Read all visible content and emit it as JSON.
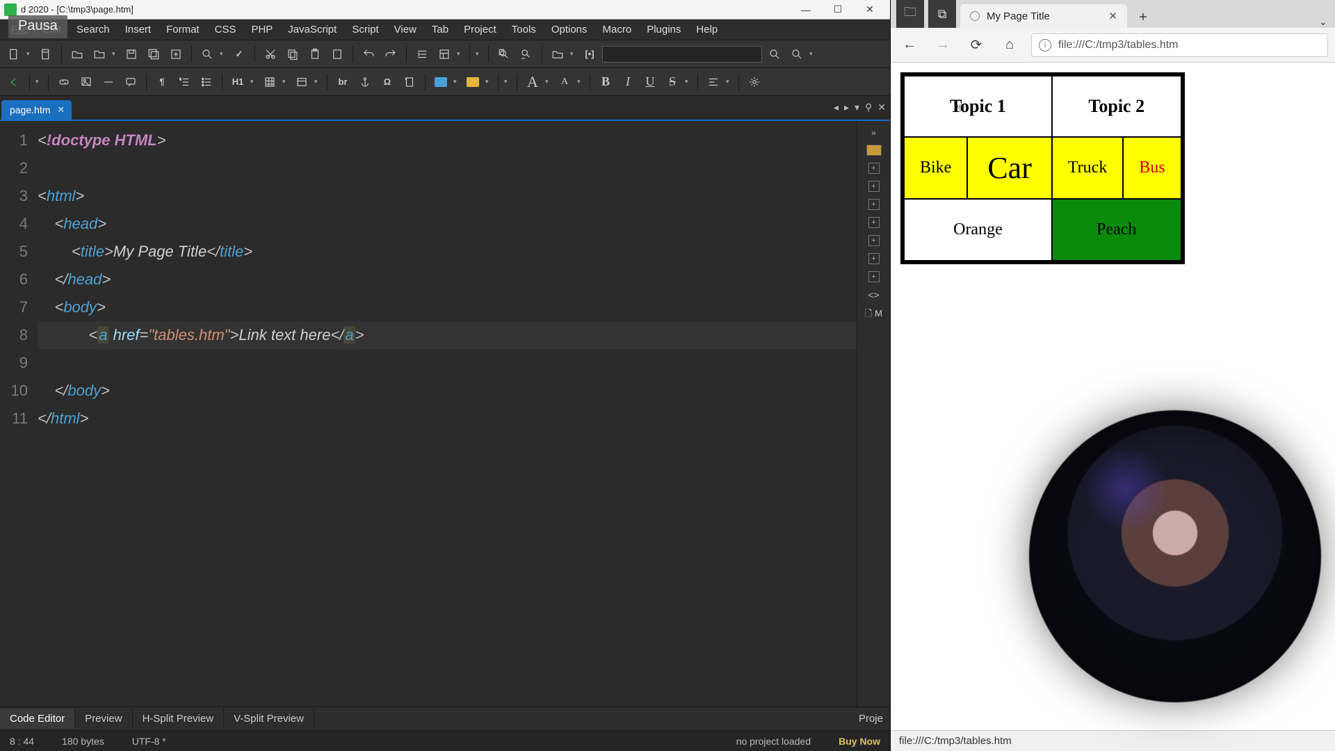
{
  "editor": {
    "titlebar": {
      "app_title_left": "",
      "app_title": "d 2020 - [C:\\tmp3\\page.htm]",
      "pausa": "Pausa"
    },
    "menu": [
      "File",
      "Edit",
      "Search",
      "Insert",
      "Format",
      "CSS",
      "PHP",
      "JavaScript",
      "Script",
      "View",
      "Tab",
      "Project",
      "Tools",
      "Options",
      "Macro",
      "Plugins",
      "Help"
    ],
    "toolbar2": {
      "br_label": "br",
      "h_label": "H1",
      "bold": "B",
      "italic": "I",
      "underline": "U",
      "strike": "S"
    },
    "file_tab": {
      "name": "page.htm"
    },
    "dock_label": "M",
    "code_lines": [
      {
        "n": "1",
        "html": "<span class='tok-punct'>&lt;</span><span class='tok-doctype'>!doctype HTML</span><span class='tok-punct'>&gt;</span>"
      },
      {
        "n": "2",
        "html": ""
      },
      {
        "n": "3",
        "html": "<span class='tok-punct'>&lt;</span><span class='tok-tag'>html</span><span class='tok-punct'>&gt;</span>"
      },
      {
        "n": "4",
        "html": "    <span class='tok-punct'>&lt;</span><span class='tok-tag'>head</span><span class='tok-punct'>&gt;</span>"
      },
      {
        "n": "5",
        "html": "        <span class='tok-punct'>&lt;</span><span class='tok-tag'>title</span><span class='tok-punct'>&gt;</span><span class='tok-text'>My Page Title</span><span class='tok-punct'>&lt;/</span><span class='tok-tag'>title</span><span class='tok-punct'>&gt;</span>"
      },
      {
        "n": "6",
        "html": "    <span class='tok-punct'>&lt;/</span><span class='tok-tag'>head</span><span class='tok-punct'>&gt;</span>"
      },
      {
        "n": "7",
        "html": "    <span class='tok-punct'>&lt;</span><span class='tok-tag'>body</span><span class='tok-punct'>&gt;</span>"
      },
      {
        "n": "8",
        "hl": true,
        "html": "            <span class='tok-punct'>&lt;</span><span class='tok-a-tag'>a</span> <span class='tok-attr'>href</span><span class='tok-punct'>=</span><span class='tok-string'>\"tables.htm\"</span><span class='tok-punct'>&gt;</span><span class='tok-text'>Link text here</span><span class='tok-punct'>&lt;/</span><span class='tok-a-tag'>a</span><span class='tok-punct'>&gt;</span>"
      },
      {
        "n": "9",
        "html": ""
      },
      {
        "n": "10",
        "html": "    <span class='tok-punct'>&lt;/</span><span class='tok-tag'>body</span><span class='tok-punct'>&gt;</span>"
      },
      {
        "n": "11",
        "html": "<span class='tok-punct'>&lt;/</span><span class='tok-tag'>html</span><span class='tok-punct'>&gt;</span>"
      }
    ],
    "bottom_tabs": [
      "Code Editor",
      "Preview",
      "H-Split Preview",
      "V-Split Preview"
    ],
    "bottom_right": "Proje",
    "status": {
      "pos": "8 : 44",
      "size": "180 bytes",
      "enc": "UTF-8 *",
      "proj": "no project loaded",
      "buy": "Buy Now"
    }
  },
  "browser": {
    "tab_title": "My Page Title",
    "address": "file:///C:/tmp3/tables.htm",
    "status": "file:///C:/tmp3/tables.htm",
    "table": {
      "headers": [
        "Topic 1",
        "Topic 2"
      ],
      "row_yellow": [
        "Bike",
        "Car",
        "Truck",
        "Bus"
      ],
      "row3": [
        "Orange",
        "Peach"
      ]
    }
  }
}
